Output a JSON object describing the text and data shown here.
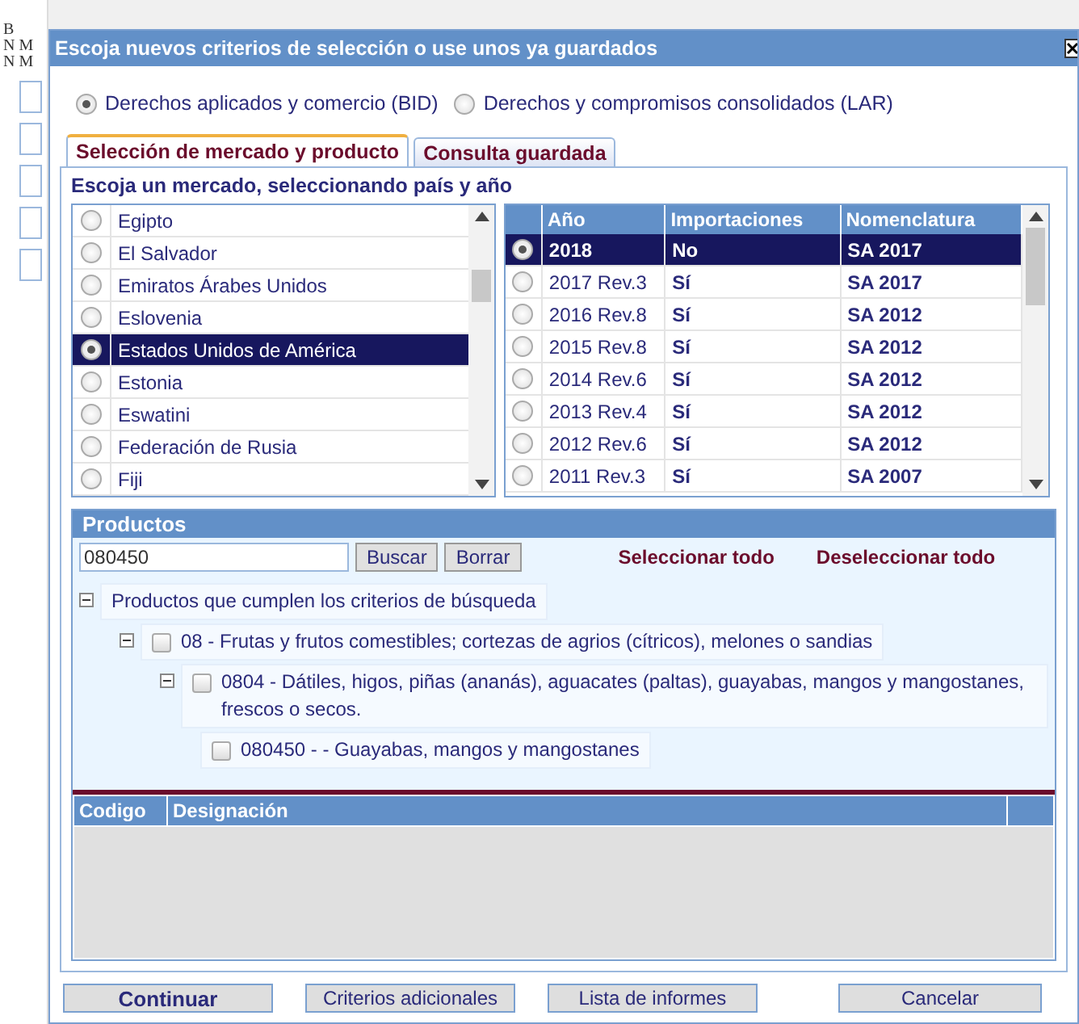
{
  "background": {
    "fragments": [
      "B",
      "N M",
      "N M"
    ]
  },
  "window": {
    "title": "Escoja nuevos criterios de selección o use unos ya guardados"
  },
  "databases": [
    {
      "label": "Derechos aplicados y comercio (BID)",
      "selected": true
    },
    {
      "label": "Derechos y compromisos consolidados (LAR)",
      "selected": false
    }
  ],
  "tabs": [
    {
      "label": "Selección de mercado y producto",
      "selected": true
    },
    {
      "label": "Consulta guardada",
      "selected": false
    }
  ],
  "market": {
    "heading": "Escoja un mercado, seleccionando país y año",
    "countries": [
      {
        "name": "Egipto",
        "selected": false
      },
      {
        "name": "El Salvador",
        "selected": false
      },
      {
        "name": "Emiratos Árabes Unidos",
        "selected": false
      },
      {
        "name": "Eslovenia",
        "selected": false
      },
      {
        "name": "Estados Unidos de América",
        "selected": true
      },
      {
        "name": "Estonia",
        "selected": false
      },
      {
        "name": "Eswatini",
        "selected": false
      },
      {
        "name": "Federación de Rusia",
        "selected": false
      },
      {
        "name": "Fiji",
        "selected": false
      }
    ],
    "years": {
      "columns": [
        "Año",
        "Importaciones",
        "Nomenclatura"
      ],
      "rows": [
        {
          "cells": [
            "2018",
            "No",
            "SA 2017"
          ],
          "selected": true
        },
        {
          "cells": [
            "2017 Rev.3",
            "Sí",
            "SA 2017"
          ],
          "selected": false
        },
        {
          "cells": [
            "2016 Rev.8",
            "Sí",
            "SA 2012"
          ],
          "selected": false
        },
        {
          "cells": [
            "2015 Rev.8",
            "Sí",
            "SA 2012"
          ],
          "selected": false
        },
        {
          "cells": [
            "2014 Rev.6",
            "Sí",
            "SA 2012"
          ],
          "selected": false
        },
        {
          "cells": [
            "2013 Rev.4",
            "Sí",
            "SA 2012"
          ],
          "selected": false
        },
        {
          "cells": [
            "2012 Rev.6",
            "Sí",
            "SA 2012"
          ],
          "selected": false
        },
        {
          "cells": [
            "2011 Rev.3",
            "Sí",
            "SA 2007"
          ],
          "selected": false
        }
      ]
    }
  },
  "products": {
    "title": "Productos",
    "search_value": "080450",
    "search_button": "Buscar",
    "clear_button": "Borrar",
    "select_all": "Seleccionar todo",
    "deselect_all": "Deseleccionar todo",
    "tree": [
      {
        "label": "Productos que cumplen los criterios de búsqueda",
        "expanded": true,
        "children": [
          {
            "label": "08 - Frutas y frutos comestibles; cortezas de agrios (cítricos), melones o sandias",
            "expanded": true,
            "checked": false,
            "children": [
              {
                "label": "0804 - Dátiles, higos, piñas (ananás), aguacates (paltas), guayabas, mangos y mangostanes, frescos o secos.",
                "expanded": true,
                "checked": false,
                "children": [
                  {
                    "label": "080450 - - Guayabas, mangos y mangostanes",
                    "checked": false
                  }
                ]
              }
            ]
          }
        ]
      }
    ],
    "selected_table": {
      "columns": [
        "Codigo",
        "Designación"
      ]
    }
  },
  "buttons": [
    {
      "label": "Continuar",
      "primary": true
    },
    {
      "label": "Criterios adicionales",
      "primary": false
    },
    {
      "label": "Lista de informes",
      "primary": false
    },
    {
      "label": "Cancelar",
      "primary": false
    }
  ]
}
